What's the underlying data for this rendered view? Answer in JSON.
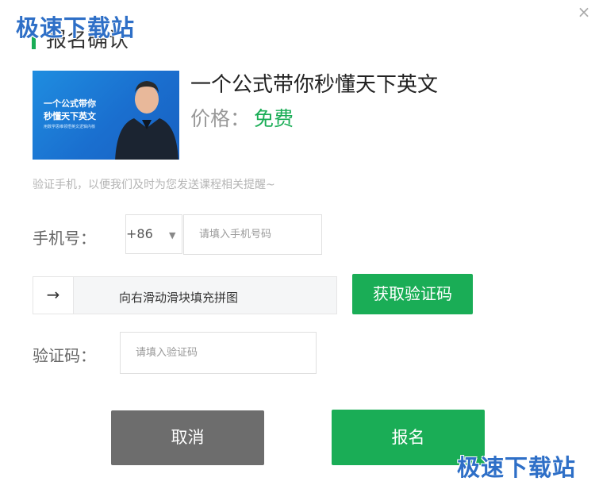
{
  "watermark": "极速下载站",
  "dialog": {
    "title": "报名确认",
    "close_icon": "×"
  },
  "course": {
    "thumbnail": {
      "line1": "一个公式带你",
      "line2": "秒懂天下英文",
      "subtitle": "用数学思维领悟英文逻辑内核"
    },
    "title": "一个公式带你秒懂天下英文",
    "price_label": "价格：",
    "price_value": "免费"
  },
  "form": {
    "hint": "验证手机，以便我们及时为您发送课程相关提醒~",
    "phone_label": "手机号：",
    "country_code": "+86",
    "country_caret": "▼",
    "phone_placeholder": "请填入手机号码",
    "slider_arrow": "→",
    "slider_text": "向右滑动滑块填充拼图",
    "get_code_button": "获取验证码",
    "code_label": "验证码：",
    "code_placeholder": "请填入验证码"
  },
  "actions": {
    "cancel": "取消",
    "signup": "报名"
  },
  "colors": {
    "accent_green": "#1aad56",
    "cancel_gray": "#6d6d6d",
    "watermark_blue": "#2e6fc7"
  }
}
